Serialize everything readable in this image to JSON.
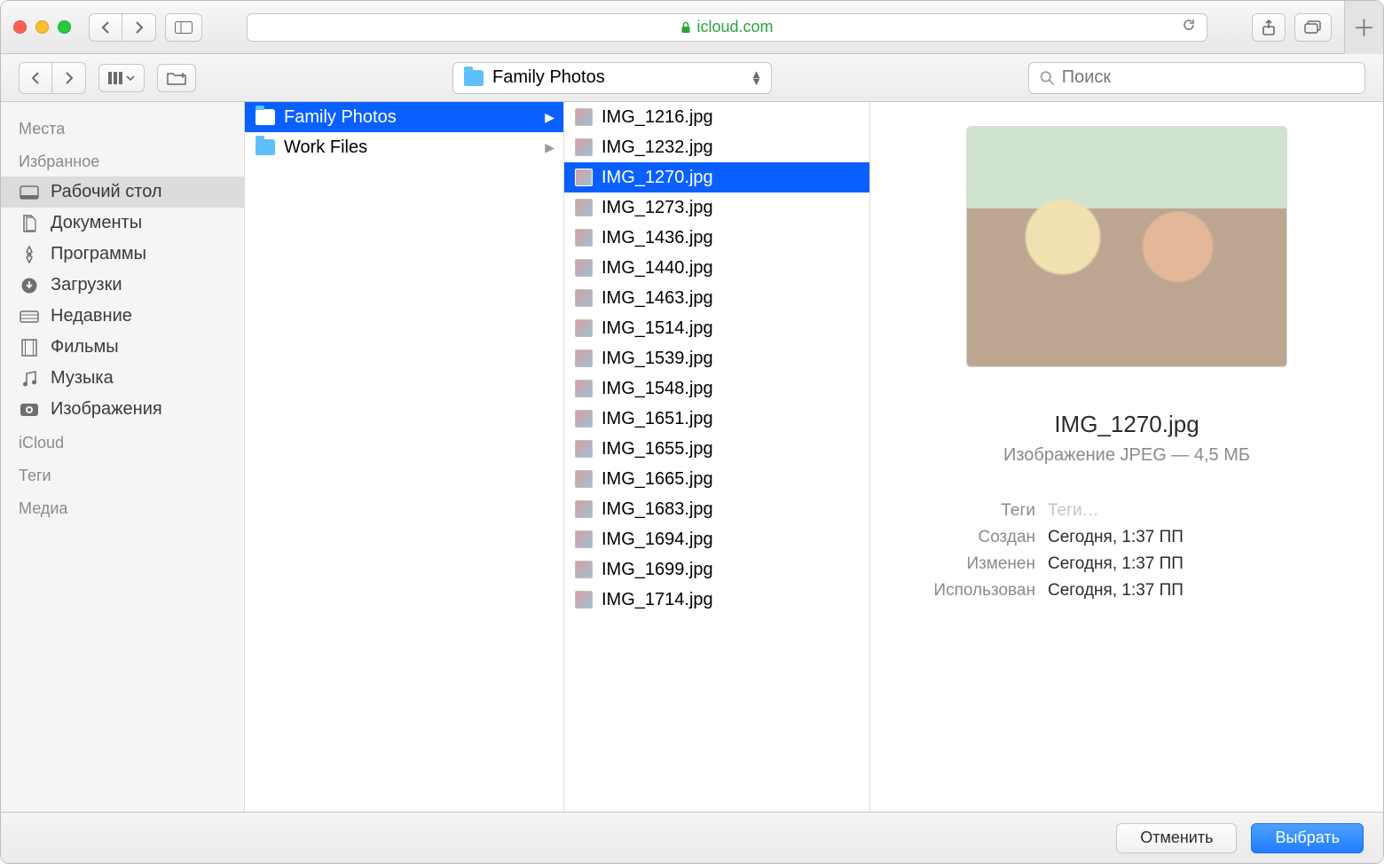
{
  "safari": {
    "url": "icloud.com"
  },
  "toolbar": {
    "path_label": "Family Photos",
    "search_placeholder": "Поиск"
  },
  "sidebar": {
    "sections": [
      {
        "header": "Места",
        "items": []
      },
      {
        "header": "Избранное",
        "items": [
          {
            "label": "Рабочий стол",
            "icon": "desktop",
            "selected": true
          },
          {
            "label": "Документы",
            "icon": "documents"
          },
          {
            "label": "Программы",
            "icon": "apps"
          },
          {
            "label": "Загрузки",
            "icon": "downloads"
          },
          {
            "label": "Недавние",
            "icon": "recents"
          },
          {
            "label": "Фильмы",
            "icon": "movies"
          },
          {
            "label": "Музыка",
            "icon": "music"
          },
          {
            "label": "Изображения",
            "icon": "pictures"
          }
        ]
      },
      {
        "header": "iCloud",
        "items": []
      },
      {
        "header": "Теги",
        "items": []
      },
      {
        "header": "Медиа",
        "items": []
      }
    ]
  },
  "folders": [
    {
      "label": "Family Photos",
      "selected": true
    },
    {
      "label": "Work Files",
      "selected": false
    }
  ],
  "files": [
    {
      "label": "IMG_1216.jpg"
    },
    {
      "label": "IMG_1232.jpg"
    },
    {
      "label": "IMG_1270.jpg",
      "selected": true
    },
    {
      "label": "IMG_1273.jpg"
    },
    {
      "label": "IMG_1436.jpg"
    },
    {
      "label": "IMG_1440.jpg"
    },
    {
      "label": "IMG_1463.jpg"
    },
    {
      "label": "IMG_1514.jpg"
    },
    {
      "label": "IMG_1539.jpg"
    },
    {
      "label": "IMG_1548.jpg"
    },
    {
      "label": "IMG_1651.jpg"
    },
    {
      "label": "IMG_1655.jpg"
    },
    {
      "label": "IMG_1665.jpg"
    },
    {
      "label": "IMG_1683.jpg"
    },
    {
      "label": "IMG_1694.jpg"
    },
    {
      "label": "IMG_1699.jpg"
    },
    {
      "label": "IMG_1714.jpg"
    }
  ],
  "preview": {
    "filename": "IMG_1270.jpg",
    "subtitle": "Изображение JPEG — 4,5 МБ",
    "meta": {
      "tags_label": "Теги",
      "tags_value": "Теги…",
      "created_label": "Создан",
      "created_value": "Сегодня, 1:37 ПП",
      "modified_label": "Изменен",
      "modified_value": "Сегодня, 1:37 ПП",
      "used_label": "Использован",
      "used_value": "Сегодня, 1:37 ПП"
    }
  },
  "buttons": {
    "cancel": "Отменить",
    "choose": "Выбрать"
  }
}
